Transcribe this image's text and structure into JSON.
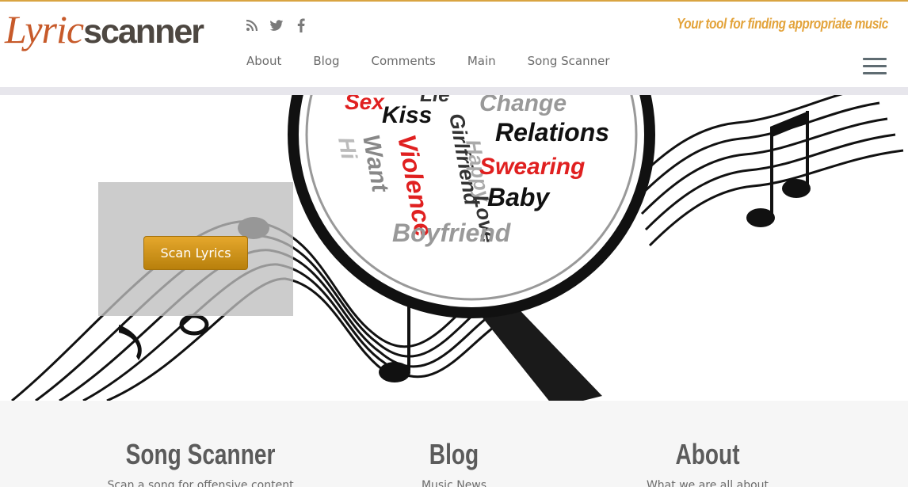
{
  "header": {
    "logo_part1": "Lyric",
    "logo_part2": "scanner",
    "tagline": "Your tool for finding appropriate music",
    "social_icons": [
      "rss-icon",
      "twitter-icon",
      "facebook-icon"
    ]
  },
  "nav": {
    "items": [
      "About",
      "Blog",
      "Comments",
      "Main",
      "Song Scanner"
    ]
  },
  "hero": {
    "button_label": "Scan Lyrics",
    "lens_words": [
      "Sex",
      "Lie",
      "Change",
      "Kiss",
      "Relations",
      "Want",
      "Girlfriend",
      "Violence",
      "Happy",
      "Swearing",
      "Love",
      "Baby",
      "Boyfriend",
      "Hi"
    ]
  },
  "features": [
    {
      "title": "Song Scanner",
      "text": "Scan a song for offensive content"
    },
    {
      "title": "Blog",
      "text": "Music News"
    },
    {
      "title": "About",
      "text": "What we are all about"
    }
  ],
  "colors": {
    "accent": "#d9a441",
    "logo_orange": "#c75a2a",
    "button": "#d4961e",
    "tagline": "#e3a33a"
  }
}
